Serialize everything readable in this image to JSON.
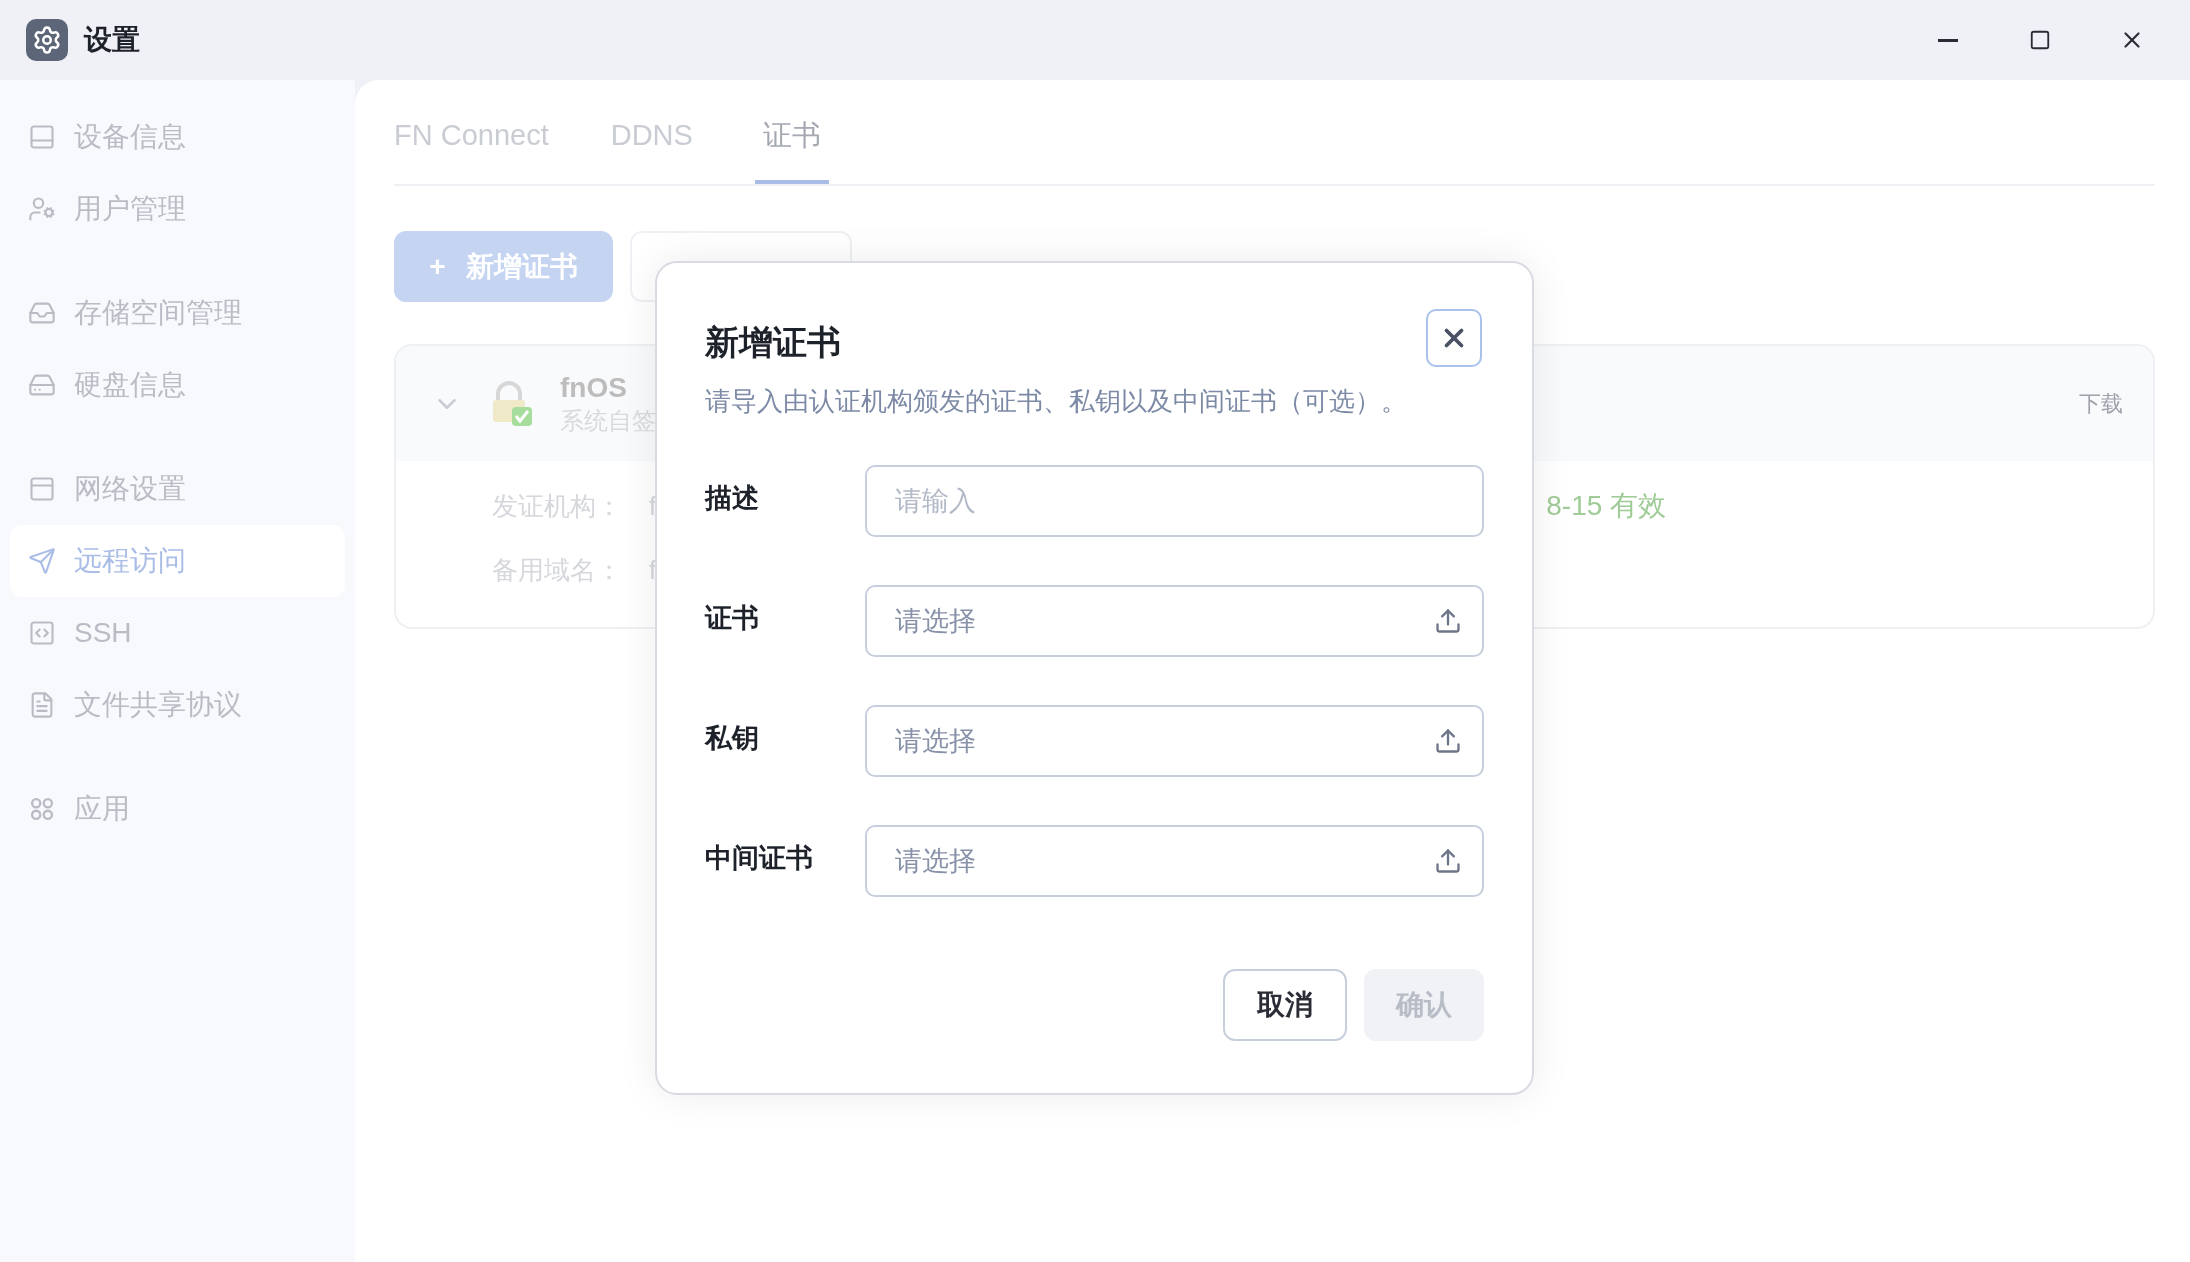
{
  "window": {
    "title": "设置"
  },
  "sidebar": {
    "groups": [
      [
        {
          "label": "设备信息",
          "selected": false
        },
        {
          "label": "用户管理",
          "selected": false
        }
      ],
      [
        {
          "label": "存储空间管理",
          "selected": false
        },
        {
          "label": "硬盘信息",
          "selected": false
        }
      ],
      [
        {
          "label": "网络设置",
          "selected": false
        },
        {
          "label": "远程访问",
          "selected": true
        },
        {
          "label": "SSH",
          "selected": false
        },
        {
          "label": "文件共享协议",
          "selected": false
        }
      ],
      [
        {
          "label": "应用",
          "selected": false
        }
      ]
    ]
  },
  "tabs": [
    {
      "label": "FN Connect",
      "selected": false
    },
    {
      "label": "DDNS",
      "selected": false
    },
    {
      "label": "证书",
      "selected": true
    }
  ],
  "toolbar": {
    "add_button": "+",
    "add_label": "新增证书"
  },
  "certificate": {
    "name": "fnOS",
    "subtitle": "系统自签",
    "download": "下载",
    "expanded": true,
    "details": [
      {
        "label": "发证机构：",
        "value": "f"
      },
      {
        "label": "备用域名：",
        "value": "f"
      }
    ],
    "validity": "8-15 有效"
  },
  "dialog": {
    "title": "新增证书",
    "description": "请导入由认证机构颁发的证书、私钥以及中间证书（可选）。",
    "fields": [
      {
        "label": "描述",
        "kind": "text",
        "placeholder": "请输入"
      },
      {
        "label": "证书",
        "kind": "file",
        "placeholder": "请选择"
      },
      {
        "label": "私钥",
        "kind": "file",
        "placeholder": "请选择"
      },
      {
        "label": "中间证书",
        "kind": "file",
        "placeholder": "请选择"
      }
    ],
    "buttons": [
      {
        "label": "取消",
        "kind": "secondary",
        "disabled": false
      },
      {
        "label": "确认",
        "kind": "primary",
        "disabled": true
      }
    ]
  }
}
